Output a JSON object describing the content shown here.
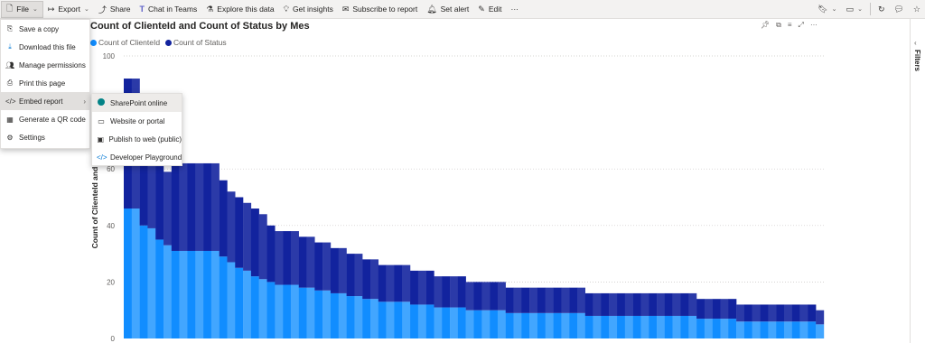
{
  "toolbar": {
    "file": "File",
    "export": "Export",
    "share": "Share",
    "chat_in_teams": "Chat in Teams",
    "explore_data": "Explore this data",
    "get_insights": "Get insights",
    "subscribe": "Subscribe to report",
    "set_alert": "Set alert",
    "edit": "Edit",
    "more": "···"
  },
  "file_menu": {
    "items": [
      {
        "label": "Save a copy",
        "icon": "save-copy-icon"
      },
      {
        "label": "Download this file",
        "icon": "download-icon"
      },
      {
        "label": "Manage permissions",
        "icon": "permissions-icon"
      },
      {
        "label": "Print this page",
        "icon": "print-icon"
      },
      {
        "label": "Embed report",
        "icon": "embed-icon"
      },
      {
        "label": "Generate a QR code",
        "icon": "qr-code-icon"
      },
      {
        "label": "Settings",
        "icon": "settings-icon"
      }
    ]
  },
  "embed_menu": {
    "items": [
      {
        "label": "SharePoint online",
        "icon": "sharepoint-icon"
      },
      {
        "label": "Website or portal",
        "icon": "website-icon"
      },
      {
        "label": "Publish to web (public)",
        "icon": "publish-web-icon"
      },
      {
        "label": "Developer Playground",
        "icon": "developer-icon"
      }
    ]
  },
  "filters_pane": {
    "label": "Filters"
  },
  "chart_data": {
    "type": "bar",
    "title": "Count of ClienteId and Count of Status by Mes",
    "ylabel": "Count of ClienteId and Count of Status",
    "ylabel_visible": "Count of ClienteId and Coun",
    "xlabel": "",
    "ylim": [
      0,
      100
    ],
    "yticks": [
      0,
      20,
      40,
      60,
      100
    ],
    "grid": true,
    "legend_position": "top-left",
    "colors": {
      "ClienteId": "#118dff",
      "Status": "#12239e",
      "ClienteId_alt": "#42a6ff",
      "Status_alt": "#2b3aa8"
    },
    "series": [
      {
        "name": "Count of ClienteId",
        "values": [
          46,
          46,
          40,
          39,
          35,
          33,
          31,
          31,
          31,
          31,
          31,
          31,
          29,
          27,
          25,
          24,
          22,
          21,
          20,
          19,
          19,
          19,
          18,
          18,
          17,
          17,
          16,
          16,
          15,
          15,
          14,
          14,
          13,
          13,
          13,
          13,
          12,
          12,
          12,
          11,
          11,
          11,
          11,
          10,
          10,
          10,
          10,
          10,
          9,
          9,
          9,
          9,
          9,
          9,
          9,
          9,
          9,
          9,
          8,
          8,
          8,
          8,
          8,
          8,
          8,
          8,
          8,
          8,
          8,
          8,
          8,
          8,
          7,
          7,
          7,
          7,
          7,
          6,
          6,
          6,
          6,
          6,
          6,
          6,
          6,
          6,
          6,
          5
        ]
      },
      {
        "name": "Count of Status",
        "values": [
          46,
          46,
          23,
          22,
          26,
          26,
          31,
          31,
          31,
          31,
          31,
          31,
          27,
          25,
          25,
          24,
          24,
          23,
          20,
          19,
          19,
          19,
          18,
          18,
          17,
          17,
          16,
          16,
          15,
          15,
          14,
          14,
          13,
          13,
          13,
          13,
          12,
          12,
          12,
          11,
          11,
          11,
          11,
          10,
          10,
          10,
          10,
          10,
          9,
          9,
          9,
          9,
          9,
          9,
          9,
          9,
          9,
          9,
          8,
          8,
          8,
          8,
          8,
          8,
          8,
          8,
          8,
          8,
          8,
          8,
          8,
          8,
          7,
          7,
          7,
          7,
          7,
          6,
          6,
          6,
          6,
          6,
          6,
          6,
          6,
          6,
          6,
          5
        ]
      }
    ]
  }
}
